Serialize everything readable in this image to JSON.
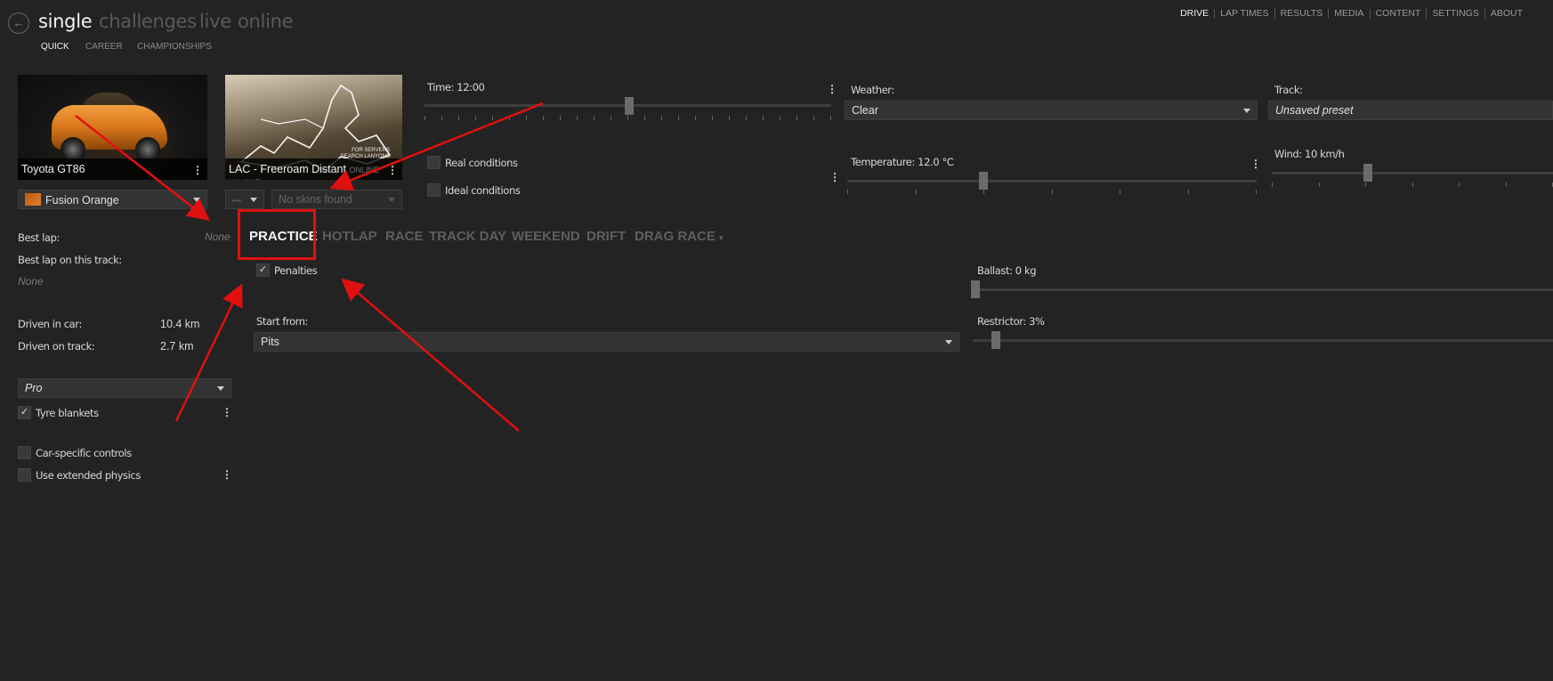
{
  "header": {
    "back_icon": "arrow-left-icon",
    "modes": [
      "single",
      "challenges",
      "live",
      "online"
    ],
    "submodes": [
      "QUICK",
      "CAREER",
      "CHAMPIONSHIPS"
    ],
    "nav": [
      "DRIVE",
      "LAP TIMES",
      "RESULTS",
      "MEDIA",
      "CONTENT",
      "SETTINGS",
      "ABOUT"
    ]
  },
  "car": {
    "name": "Toyota GT86",
    "skin": "Fusion Orange"
  },
  "track": {
    "name": "LAC - Freeroam Distant",
    "overlay_text_1": "FOR SERVERS",
    "overlay_text_2": "SEARCH LANYONS",
    "ghost_text": "ONLINE LAYOUT",
    "skin_placeholder": "No skins found"
  },
  "stats": {
    "best_lap_label": "Best lap:",
    "best_lap_value": "None",
    "best_lap_track_label": "Best lap on this track:",
    "best_lap_track_value": "None",
    "driven_car_label": "Driven in car:",
    "driven_car_value": "10.4 km",
    "driven_track_label": "Driven on track:",
    "driven_track_value": "2.7 km"
  },
  "assists": {
    "preset": "Pro",
    "tyre_blankets_label": "Tyre blankets",
    "tyre_blankets_checked": true,
    "car_controls_label": "Car-specific controls",
    "car_controls_checked": false,
    "extended_physics_label": "Use extended physics",
    "extended_physics_checked": false
  },
  "conditions": {
    "time_label": "Time: 12:00",
    "time_fraction": 0.5,
    "real_conditions_label": "Real conditions",
    "ideal_conditions_label": "Ideal conditions",
    "weather_label": "Weather:",
    "weather_value": "Clear",
    "temperature_label": "Temperature: 12.0 °C",
    "temperature_fraction": 0.33,
    "track_label": "Track:",
    "track_value": "Unsaved preset",
    "wind_label": "Wind: 10 km/h"
  },
  "race_tabs": [
    "PRACTICE",
    "HOTLAP",
    "RACE",
    "TRACK DAY",
    "WEEKEND",
    "DRIFT",
    "DRAG RACE"
  ],
  "practice": {
    "penalties_label": "Penalties",
    "penalties_checked": true,
    "start_from_label": "Start from:",
    "start_from_value": "Pits",
    "ballast_label": "Ballast: 0 kg",
    "restrictor_label": "Restrictor: 3%"
  },
  "colors": {
    "background": "#232323",
    "annotation": "#e01010",
    "accent_car": "#d8761a"
  }
}
